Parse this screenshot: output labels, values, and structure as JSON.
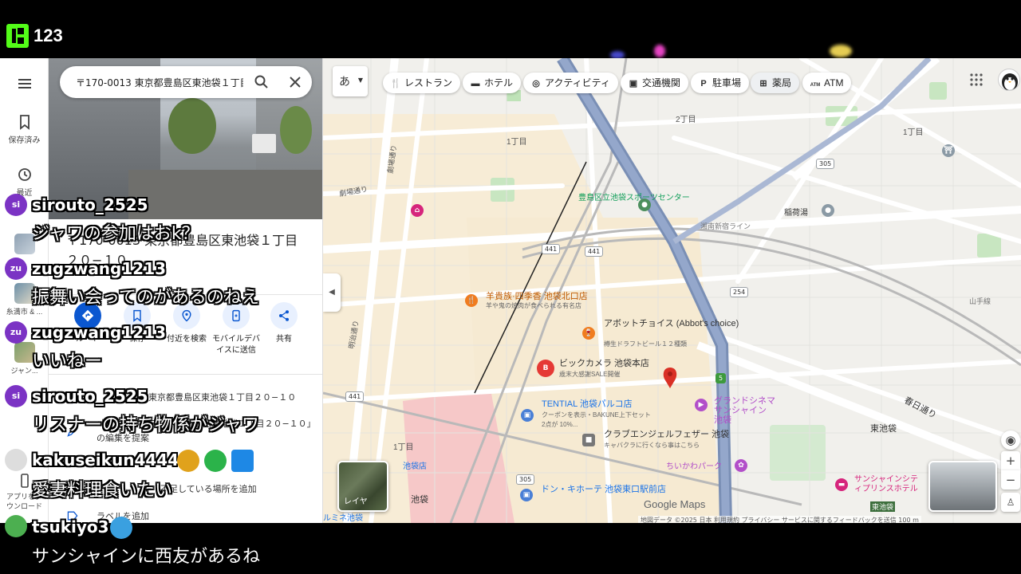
{
  "stream": {
    "viewer_count": "123"
  },
  "rail": {
    "menu_label": "",
    "saved_label": "保存済み",
    "recent_label": "最近",
    "item_itoman": "糸満市 & ...",
    "item_genre": "ジャン...",
    "item_app_download": "アプリをダウンロード"
  },
  "panel": {
    "search_query": "〒170-0013 東京都豊島区東池袋１丁目",
    "place_title": "〒170-0013 東京都豊島区東池袋１丁目２０−１０",
    "actions": [
      {
        "label": "ルート"
      },
      {
        "label": "保存"
      },
      {
        "label": "付近を検索"
      },
      {
        "label": "モバイルデバイスに送信"
      },
      {
        "label": "共有"
      }
    ],
    "address_row": "東京都豊島区東池袋１丁目２０−１０",
    "suggest_row": "「〒170-0013 東京都豊島区東池袋１丁目２０−１０」の編集を提案",
    "add_place_row": "不足している場所を追加",
    "add_label_row": "ラベルを追加"
  },
  "map": {
    "ime_label": "あ",
    "chips": [
      {
        "icon": "restaurant-icon",
        "label": "レストラン"
      },
      {
        "icon": "hotel-icon",
        "label": "ホテル"
      },
      {
        "icon": "camera-icon",
        "label": "アクティビティ"
      },
      {
        "icon": "transit-icon",
        "label": "交通機関"
      },
      {
        "icon": "parking-icon",
        "label": "駐車場"
      },
      {
        "icon": "pharmacy-icon",
        "label": "薬局"
      },
      {
        "icon": "atm-icon",
        "label": "ATM"
      }
    ],
    "labels": {
      "l_2chome": "2丁目",
      "l_1chome_top": "1丁目",
      "l_1chome_right": "1丁目",
      "l_1chome_bottom": "1丁目",
      "l_higashi": "東池袋",
      "l_inari": "稲荷湯",
      "l_shonan": "湘南新宿ライン",
      "l_yamanote": "山手線",
      "l_kasuga": "春日通り",
      "l_meiji": "明治通り",
      "l_gekijo": "劇場通り",
      "l_gekijo2": "劇場通り",
      "l_sports": "豊島区立池袋スポーツセンター",
      "l_yangui": "羊貴族·四季香 池袋北口店",
      "l_yangui_sub": "羊や鬼の焼肉が食べられる有名店",
      "l_abbot": "アボットチョイス (Abbot's choice)",
      "l_abbot_sub": "樽生ドラフトビール１２種類",
      "l_bic": "ビックカメラ 池袋本店",
      "l_bic_sub": "歳末大感謝SALE開催",
      "l_tential": "TENTIAL 池袋パルコ店",
      "l_tential_sub": "クーポンを表示・BAKUNE上下セット2点が 10%...",
      "l_club": "クラブエンジェルフェザー 池袋",
      "l_club_sub": "キャバクラに行くなら事はこちら",
      "l_grand": "グランドシネマサンシャイン 池袋",
      "l_chiikawa": "ちいかわパーク",
      "l_donki": "ドン・キホーテ 池袋東口駅前店",
      "l_sunprince": "サンシャインシティプリンスホテル",
      "l_ikebukuro": "池袋",
      "l_ikebukuro_store": "池袋店",
      "l_lumine": "ルミネ池袋",
      "l_higashiike_st": "東池袋"
    },
    "routes": [
      "441",
      "441",
      "441",
      "305",
      "305",
      "254",
      "5"
    ],
    "layers_label": "レイヤ",
    "google_logo": "Google Maps",
    "attribution": "地図データ ©2025   日本   利用規約   プライバシー   サービスに関するフィードバックを送信   100 m"
  },
  "chat": [
    {
      "avatar": "si",
      "user": "sirouto_2525",
      "text": "ジャワの参加はおk？",
      "color": "#7b33c4"
    },
    {
      "avatar": "zu",
      "user": "zugzwang1213",
      "text": "振舞い会ってのがあるのねえ",
      "color": "#7b33c4"
    },
    {
      "avatar": "zu",
      "user": "zugzwang1213",
      "text": "いいねー",
      "color": "#7b33c4"
    },
    {
      "avatar": "si",
      "user": "sirouto_2525",
      "text": "リスナーの持ち物係がジャワ",
      "color": "#7b33c4"
    },
    {
      "avatar": "",
      "user": "kakuseikun4444",
      "text": "愛妻料理食いたい",
      "color": "#ffffff"
    },
    {
      "avatar": "",
      "user": "tsukiyo3",
      "text": "サンシャインに西友があるね",
      "color": "#4caf50"
    }
  ]
}
